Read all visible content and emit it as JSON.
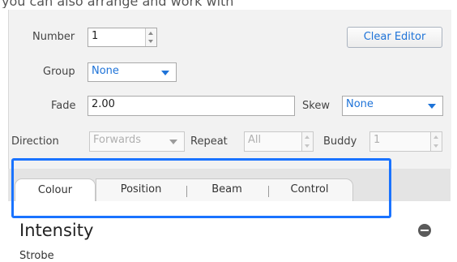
{
  "header": {
    "cutoff_text": "you can also arrange and work with"
  },
  "editor": {
    "number": {
      "label": "Number",
      "value": "1"
    },
    "clear_button": "Clear Editor",
    "group": {
      "label": "Group",
      "value": "None"
    },
    "fade": {
      "label": "Fade",
      "value": "2.00"
    },
    "skew": {
      "label": "Skew",
      "value": "None"
    },
    "direction": {
      "label": "Direction",
      "value": "Forwards"
    },
    "repeat": {
      "label": "Repeat",
      "value": "All"
    },
    "buddy": {
      "label": "Buddy",
      "value": "1"
    }
  },
  "tabs": [
    {
      "label": "Colour",
      "active": true
    },
    {
      "label": "Position"
    },
    {
      "label": "Beam"
    },
    {
      "label": "Control"
    }
  ],
  "section": {
    "title": "Intensity",
    "sub_label": "Strobe"
  },
  "colors": {
    "accent": "#1e73d8",
    "highlight": "#1a73ff"
  }
}
